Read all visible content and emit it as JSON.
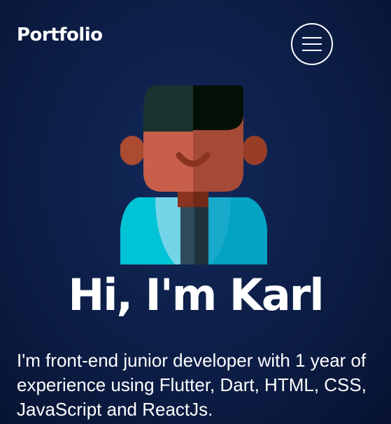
{
  "header": {
    "logo_text": "Portfolio",
    "menu_icon": "hamburger-menu-icon"
  },
  "hero": {
    "avatar_icon": "developer-avatar-icon",
    "headline": "Hi, I'm Karl",
    "intro": "I'm front-end junior developer with 1 year of experience using Flutter, Dart, HTML, CSS, JavaScript and ReactJs."
  },
  "colors": {
    "background_center": "#13295a",
    "background_edge": "#071230",
    "text": "#ffffff",
    "skin_light": "#c75f4a",
    "skin_dark": "#a54a36",
    "hair_light": "#193230",
    "hair_dark": "#031006",
    "shirt_light": "#01c3d6",
    "shirt_dark": "#03a3c2",
    "collar": "#75d4e8",
    "tie": "#263d48"
  }
}
